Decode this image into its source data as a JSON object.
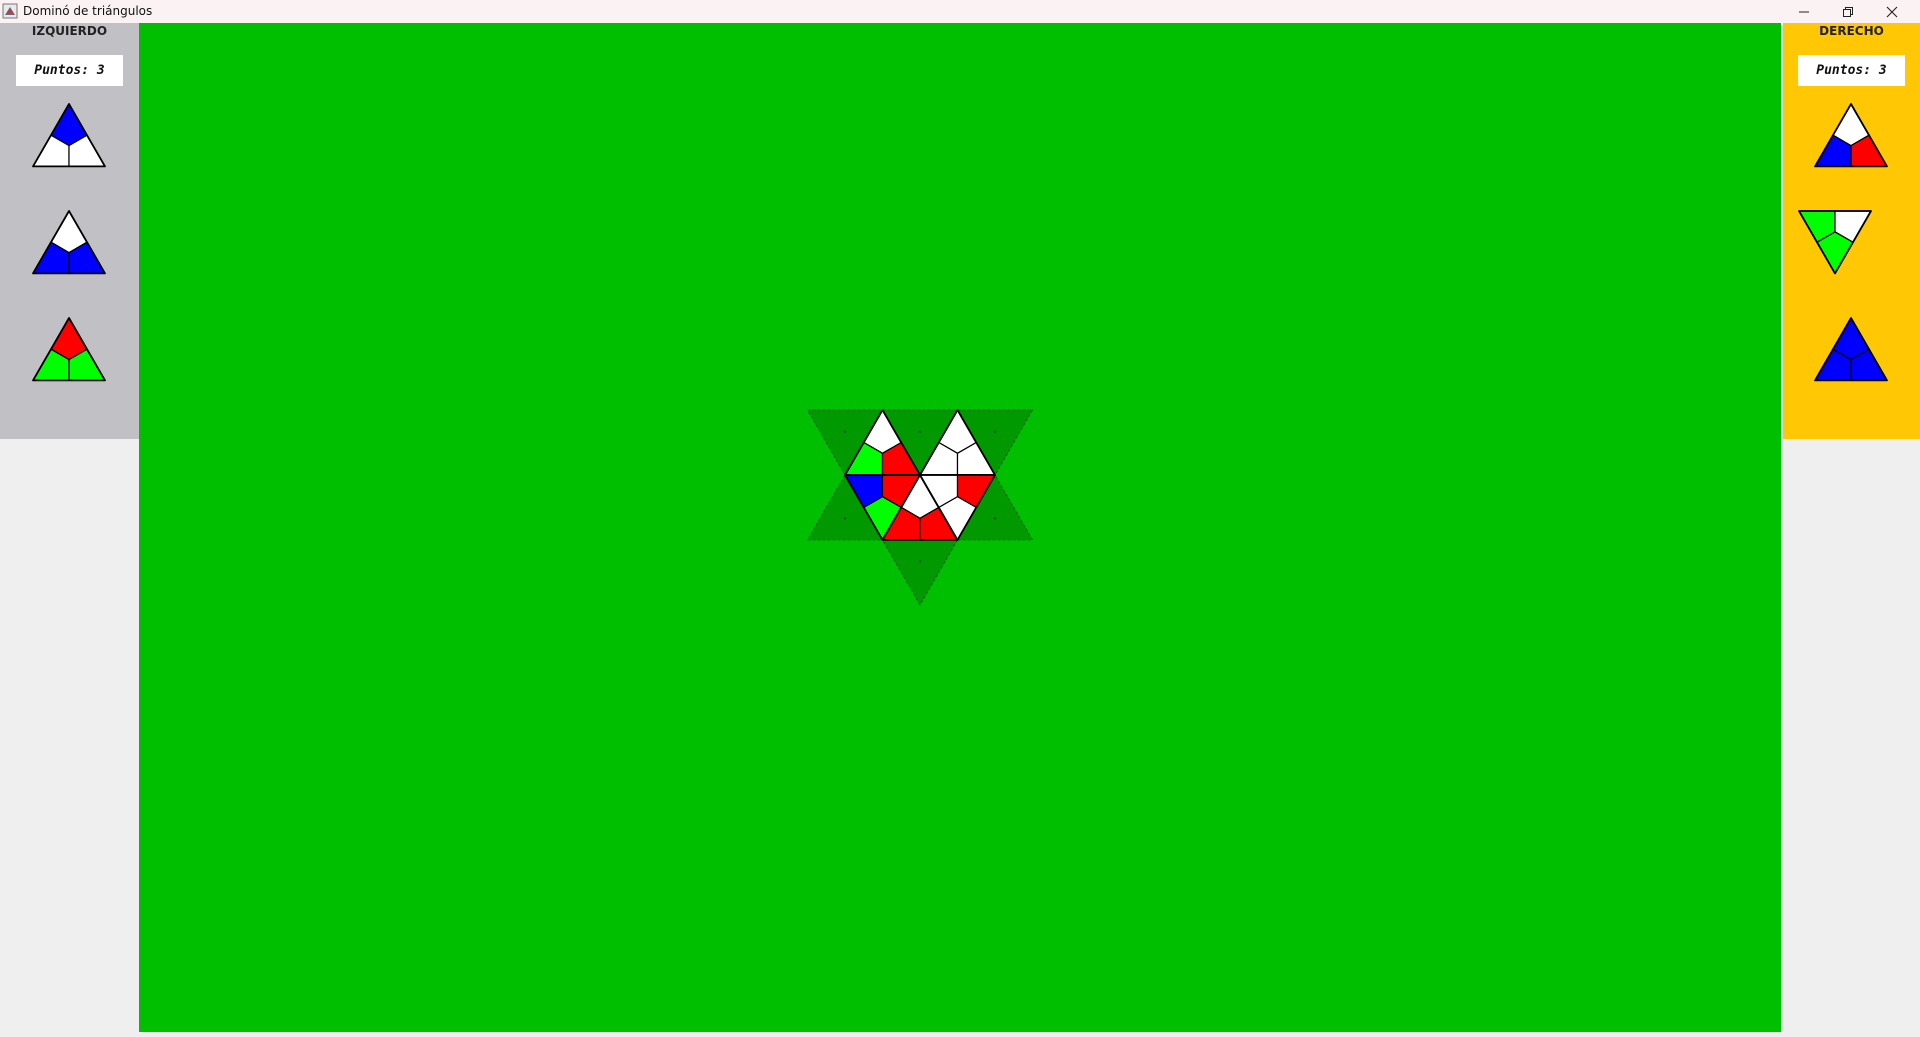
{
  "window": {
    "title": "Dominó de triángulos",
    "app_icon": "java-cup-icon",
    "controls": [
      "minimize-icon",
      "restore-icon",
      "close-icon"
    ]
  },
  "players": [
    {
      "name": "IZQUIERDO",
      "score_label": "Puntos:",
      "score": "3",
      "panel_color": "#c1c0c4",
      "hand": [
        {
          "orientation": "up",
          "colors": [
            "blue",
            "white",
            "white"
          ]
        },
        {
          "orientation": "up",
          "colors": [
            "white",
            "blue",
            "blue"
          ]
        },
        {
          "orientation": "up",
          "colors": [
            "red",
            "green",
            "green"
          ]
        }
      ]
    },
    {
      "name": "DERECHO",
      "score_label": "Puntos:",
      "score": "3",
      "panel_color": "#ffc704",
      "hand": [
        {
          "orientation": "up",
          "colors": [
            "white",
            "blue",
            "red"
          ]
        },
        {
          "orientation": "down",
          "colors": [
            "green",
            "green",
            "white"
          ]
        },
        {
          "orientation": "up",
          "colors": [
            "blue",
            "blue",
            "blue"
          ]
        }
      ]
    }
  ],
  "board": {
    "background": "#00bf00",
    "slot_color": "#009a00",
    "colors": {
      "white": "#ffffff",
      "red": "#ff0000",
      "green": "#00ff00",
      "blue": "#0000ff"
    },
    "placed_tiles": [
      {
        "orientation": "up",
        "colors": [
          "white",
          "green",
          "red"
        ]
      },
      {
        "orientation": "up",
        "colors": [
          "white",
          "white",
          "white"
        ]
      },
      {
        "orientation": "down",
        "colors": [
          "green",
          "blue",
          "red"
        ]
      },
      {
        "orientation": "up",
        "colors": [
          "white",
          "red",
          "red"
        ]
      },
      {
        "orientation": "down",
        "colors": [
          "white",
          "white",
          "red"
        ]
      }
    ],
    "empty_slots": 6
  }
}
